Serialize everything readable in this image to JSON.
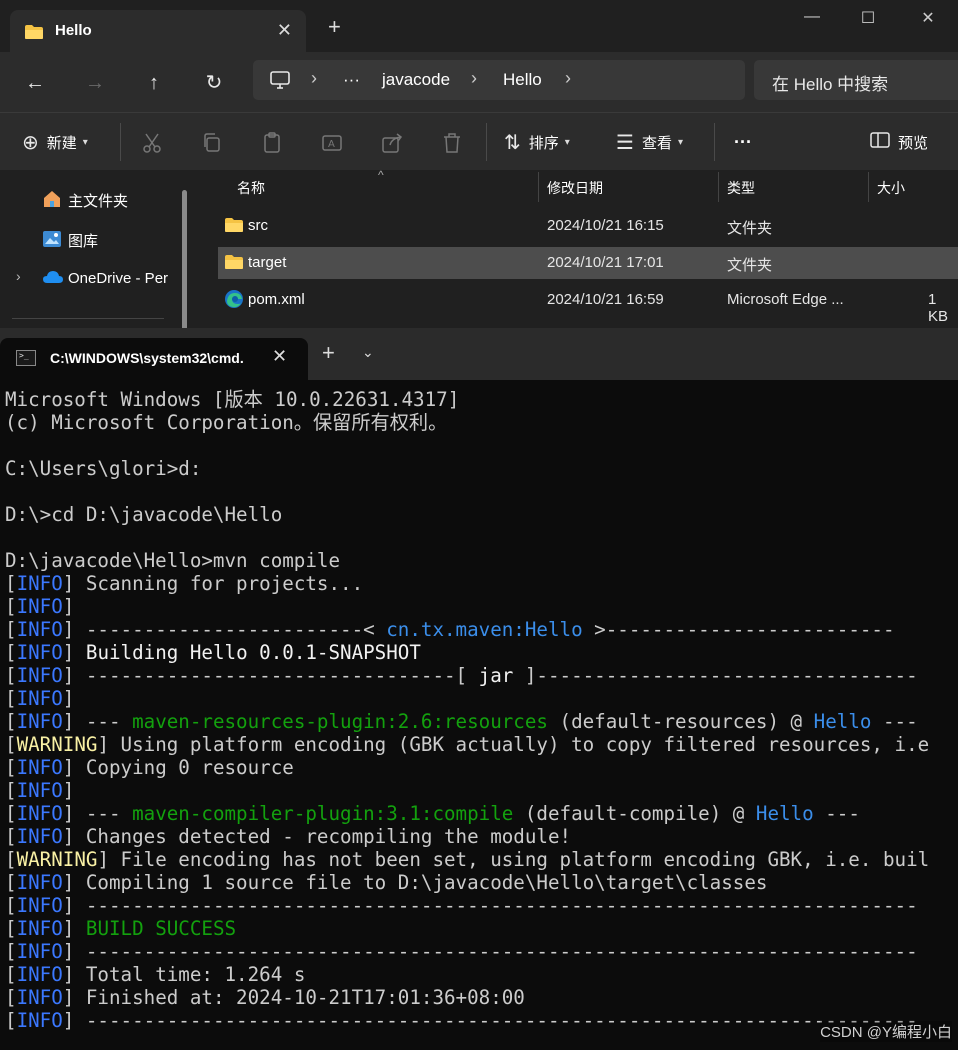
{
  "explorer": {
    "tab_title": "Hello",
    "window_controls": {
      "minimize": "—",
      "maximize": "☐",
      "close": "✕"
    },
    "breadcrumb": [
      "javacode",
      "Hello"
    ],
    "breadcrumb_more": "···",
    "search_placeholder": "在 Hello 中搜索",
    "toolbar": {
      "new_label": "新建",
      "sort_label": "排序",
      "view_label": "查看",
      "more_label": "···",
      "preview_label": "预览"
    },
    "sidebar": [
      {
        "label": "主文件夹",
        "icon": "home-icon"
      },
      {
        "label": "图库",
        "icon": "gallery-icon"
      },
      {
        "label": "OneDrive - Per",
        "icon": "onedrive-icon"
      }
    ],
    "columns": {
      "name": "名称",
      "modified": "修改日期",
      "type": "类型",
      "size": "大小"
    },
    "files": [
      {
        "name": "src",
        "modified": "2024/10/21 16:15",
        "type": "文件夹",
        "size": "",
        "icon": "folder-icon",
        "selected": false
      },
      {
        "name": "target",
        "modified": "2024/10/21 17:01",
        "type": "文件夹",
        "size": "",
        "icon": "folder-icon",
        "selected": true
      },
      {
        "name": "pom.xml",
        "modified": "2024/10/21 16:59",
        "type": "Microsoft Edge ...",
        "size": "1 KB",
        "icon": "edge-icon",
        "selected": false
      }
    ]
  },
  "terminal": {
    "tab_title": "C:\\WINDOWS\\system32\\cmd.",
    "lines": [
      [
        {
          "t": "Microsoft Windows [版本 10.0.22631.4317]",
          "c": ""
        }
      ],
      [
        {
          "t": "(c) Microsoft Corporation。保留所有权利。",
          "c": ""
        }
      ],
      [
        {
          "t": "",
          "c": ""
        }
      ],
      [
        {
          "t": "C:\\Users\\glori>d:",
          "c": ""
        }
      ],
      [
        {
          "t": "",
          "c": ""
        }
      ],
      [
        {
          "t": "D:\\>cd D:\\javacode\\Hello",
          "c": ""
        }
      ],
      [
        {
          "t": "",
          "c": ""
        }
      ],
      [
        {
          "t": "D:\\javacode\\Hello>mvn compile",
          "c": ""
        }
      ],
      [
        {
          "t": "[",
          "c": ""
        },
        {
          "t": "INFO",
          "c": "c-info"
        },
        {
          "t": "] Scanning for projects...",
          "c": ""
        }
      ],
      [
        {
          "t": "[",
          "c": ""
        },
        {
          "t": "INFO",
          "c": "c-info"
        },
        {
          "t": "]",
          "c": ""
        }
      ],
      [
        {
          "t": "[",
          "c": ""
        },
        {
          "t": "INFO",
          "c": "c-info"
        },
        {
          "t": "] ------------------------< ",
          "c": ""
        },
        {
          "t": "cn.tx.maven:Hello",
          "c": "c-blue"
        },
        {
          "t": " >-------------------------",
          "c": ""
        }
      ],
      [
        {
          "t": "[",
          "c": ""
        },
        {
          "t": "INFO",
          "c": "c-info"
        },
        {
          "t": "] ",
          "c": ""
        },
        {
          "t": "Building Hello 0.0.1-SNAPSHOT",
          "c": "c-white"
        }
      ],
      [
        {
          "t": "[",
          "c": ""
        },
        {
          "t": "INFO",
          "c": "c-info"
        },
        {
          "t": "] --------------------------------[ ",
          "c": ""
        },
        {
          "t": "jar",
          "c": "c-white"
        },
        {
          "t": " ]---------------------------------",
          "c": ""
        }
      ],
      [
        {
          "t": "[",
          "c": ""
        },
        {
          "t": "INFO",
          "c": "c-info"
        },
        {
          "t": "]",
          "c": ""
        }
      ],
      [
        {
          "t": "[",
          "c": ""
        },
        {
          "t": "INFO",
          "c": "c-info"
        },
        {
          "t": "] --- ",
          "c": ""
        },
        {
          "t": "maven-resources-plugin:2.6:resources",
          "c": "c-green"
        },
        {
          "t": " (default-resources) @ ",
          "c": ""
        },
        {
          "t": "Hello",
          "c": "c-blue"
        },
        {
          "t": " ---",
          "c": ""
        }
      ],
      [
        {
          "t": "[",
          "c": ""
        },
        {
          "t": "WARNING",
          "c": "c-warn"
        },
        {
          "t": "] Using platform encoding (GBK actually) to copy filtered resources, i.e",
          "c": ""
        }
      ],
      [
        {
          "t": "[",
          "c": ""
        },
        {
          "t": "INFO",
          "c": "c-info"
        },
        {
          "t": "] Copying 0 resource",
          "c": ""
        }
      ],
      [
        {
          "t": "[",
          "c": ""
        },
        {
          "t": "INFO",
          "c": "c-info"
        },
        {
          "t": "]",
          "c": ""
        }
      ],
      [
        {
          "t": "[",
          "c": ""
        },
        {
          "t": "INFO",
          "c": "c-info"
        },
        {
          "t": "] --- ",
          "c": ""
        },
        {
          "t": "maven-compiler-plugin:3.1:compile",
          "c": "c-green"
        },
        {
          "t": " (default-compile) @ ",
          "c": ""
        },
        {
          "t": "Hello",
          "c": "c-blue"
        },
        {
          "t": " ---",
          "c": ""
        }
      ],
      [
        {
          "t": "[",
          "c": ""
        },
        {
          "t": "INFO",
          "c": "c-info"
        },
        {
          "t": "] Changes detected - recompiling the module!",
          "c": ""
        }
      ],
      [
        {
          "t": "[",
          "c": ""
        },
        {
          "t": "WARNING",
          "c": "c-warn"
        },
        {
          "t": "] File encoding has not been set, using platform encoding GBK, i.e. buil",
          "c": ""
        }
      ],
      [
        {
          "t": "[",
          "c": ""
        },
        {
          "t": "INFO",
          "c": "c-info"
        },
        {
          "t": "] Compiling 1 source file to D:\\javacode\\Hello\\target\\classes",
          "c": ""
        }
      ],
      [
        {
          "t": "[",
          "c": ""
        },
        {
          "t": "INFO",
          "c": "c-info"
        },
        {
          "t": "] ------------------------------------------------------------------------",
          "c": ""
        }
      ],
      [
        {
          "t": "[",
          "c": ""
        },
        {
          "t": "INFO",
          "c": "c-info"
        },
        {
          "t": "] ",
          "c": ""
        },
        {
          "t": "BUILD SUCCESS",
          "c": "c-green"
        }
      ],
      [
        {
          "t": "[",
          "c": ""
        },
        {
          "t": "INFO",
          "c": "c-info"
        },
        {
          "t": "] ------------------------------------------------------------------------",
          "c": ""
        }
      ],
      [
        {
          "t": "[",
          "c": ""
        },
        {
          "t": "INFO",
          "c": "c-info"
        },
        {
          "t": "] Total time: 1.264 s",
          "c": ""
        }
      ],
      [
        {
          "t": "[",
          "c": ""
        },
        {
          "t": "INFO",
          "c": "c-info"
        },
        {
          "t": "] Finished at: 2024-10-21T17:01:36+08:00",
          "c": ""
        }
      ],
      [
        {
          "t": "[",
          "c": ""
        },
        {
          "t": "INFO",
          "c": "c-info"
        },
        {
          "t": "] ------------------------------------------------------------------------",
          "c": ""
        }
      ]
    ]
  },
  "watermark": "CSDN @Y编程小白",
  "colors": {
    "info": "#3b78ff",
    "warning": "#f9f1a5",
    "green": "#13a10e",
    "blue": "#3b8eea"
  }
}
